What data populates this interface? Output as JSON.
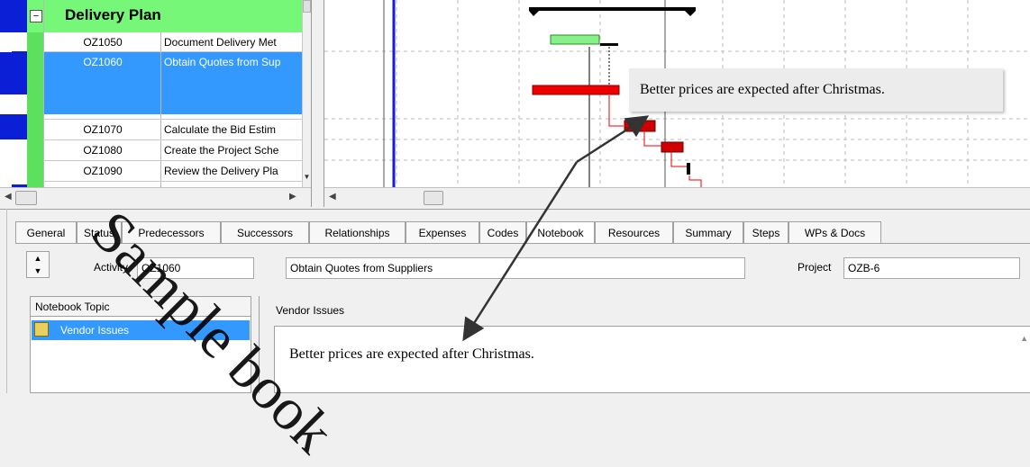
{
  "activity_table": {
    "group_label": "Delivery Plan",
    "collapse_glyph": "⊟",
    "rows": [
      {
        "id": "OZ1050",
        "name": "Document Delivery Met"
      },
      {
        "id": "OZ1060",
        "name": "Obtain Quotes from Sup"
      },
      {
        "id": "OZ1070",
        "name": "Calculate the Bid Estim"
      },
      {
        "id": "OZ1080",
        "name": "Create the Project Sche"
      },
      {
        "id": "OZ1090",
        "name": "Review the Delivery Pla"
      }
    ]
  },
  "tabs": [
    "General",
    "Status",
    "Predecessors",
    "Successors",
    "Relationships",
    "Expenses",
    "Codes",
    "Notebook",
    "Resources",
    "Summary",
    "Steps",
    "WPs & Docs"
  ],
  "active_tab": "Notebook",
  "detail": {
    "activity_label": "Activity",
    "activity_id": "OZ1060",
    "activity_name": "Obtain Quotes from Suppliers",
    "project_label": "Project",
    "project_id": "OZB-6"
  },
  "notebook": {
    "topic_header": "Notebook Topic",
    "topics": [
      "Vendor Issues"
    ],
    "content_header": "Vendor Issues",
    "content_text": "Better prices are expected after Christmas."
  },
  "callout_text": "Better prices are expected after Christmas.",
  "watermark_text": "Sample book",
  "colors": {
    "selected_row": "#3399ff",
    "group_green": "#77f777",
    "bar_red": "#ee0000",
    "bar_green": "#88f088",
    "strip_blue": "#0a1fd6"
  }
}
